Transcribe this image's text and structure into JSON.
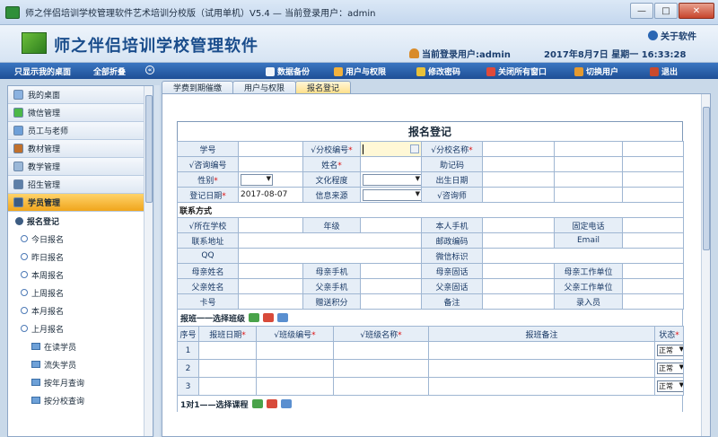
{
  "window": {
    "title": "师之伴侣培训学校管理软件艺术培训分校版（试用单机）V5.4 — 当前登录用户：admin"
  },
  "banner": {
    "app_title": "师之伴侣培训学校管理软件",
    "about": "关于软件",
    "user_label": "当前登录用户:admin",
    "date_text": "2017年8月7日  星期一   16:33:28"
  },
  "toolbar": {
    "show_desktop": "只显示我的桌面",
    "collapse_all": "全部折叠",
    "backup": "数据备份",
    "users_perms": "用户与权限",
    "change_password": "修改密码",
    "close_all": "关闭所有窗口",
    "switch_user": "切换用户",
    "exit": "退出"
  },
  "sidebar": {
    "items": [
      {
        "label": "我的桌面"
      },
      {
        "label": "微信管理"
      },
      {
        "label": "员工与老师"
      },
      {
        "label": "教材管理"
      },
      {
        "label": "教学管理"
      },
      {
        "label": "招生管理"
      },
      {
        "label": "学员管理"
      }
    ],
    "sub": {
      "register": "报名登记",
      "today": "今日报名",
      "yesterday": "昨日报名",
      "this_week": "本周报名",
      "last_week": "上周报名",
      "this_month": "本月报名",
      "last_month": "上月报名",
      "studying": "在读学员",
      "lost": "流失学员",
      "by_year": "按年月查询",
      "by_campus": "按分校查询"
    }
  },
  "tabs": [
    "学费到期催缴",
    "用户与权限",
    "报名登记"
  ],
  "form": {
    "title": "报名登记",
    "labels": {
      "student_no": "学号",
      "campus_no": "√分校编号",
      "campus_name": "√分校名称",
      "consult_no": "√咨询编号",
      "name": "姓名",
      "mnemonic": "助记码",
      "gender": "性别",
      "education": "文化程度",
      "birthday": "出生日期",
      "reg_date": "登记日期",
      "info_source": "信息来源",
      "consultant": "√咨询师",
      "contact_section": "联系方式",
      "school": "√所在学校",
      "grade": "年级",
      "mobile": "本人手机",
      "phone": "固定电话",
      "address": "联系地址",
      "postcode": "邮政编码",
      "email": "Email",
      "qq": "QQ",
      "wechat": "微信标识",
      "mother_name": "母亲姓名",
      "mother_mobile": "母亲手机",
      "mother_phone": "母亲固话",
      "mother_work": "母亲工作单位",
      "father_name": "父亲姓名",
      "father_mobile": "父亲手机",
      "father_phone": "父亲固话",
      "father_work": "父亲工作单位",
      "card_no": "卡号",
      "gift_points": "赠送积分",
      "remark": "备注",
      "entered_by": "录入员"
    },
    "values": {
      "reg_date": "2017-08-07"
    },
    "class_section": {
      "title": "报班一一选择班级",
      "headers": [
        "序号",
        "报班日期",
        "√班级编号",
        "√班级名称",
        "报班备注",
        "状态"
      ],
      "rows": [
        {
          "no": "1",
          "status": "正常"
        },
        {
          "no": "2",
          "status": "正常"
        },
        {
          "no": "3",
          "status": "正常"
        }
      ]
    },
    "course_section": {
      "title": "1对1——选择课程"
    }
  }
}
